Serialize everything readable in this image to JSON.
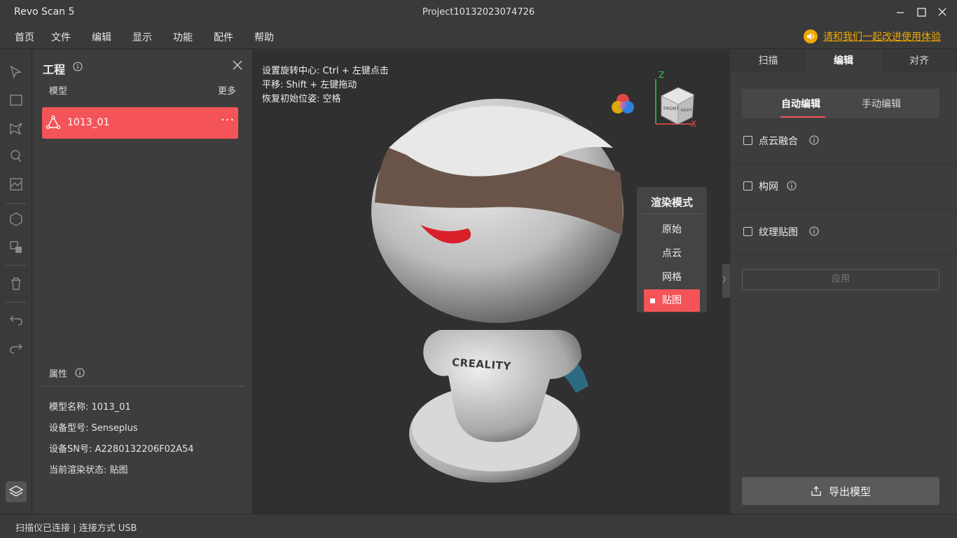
{
  "window": {
    "app_title": "Revo Scan 5",
    "project_title": "Project10132023074726"
  },
  "menu": {
    "items": [
      "首页",
      "文件",
      "编辑",
      "显示",
      "功能",
      "配件",
      "帮助"
    ],
    "feedback_link": "请和我们一起改进使用体验",
    "feedback_icon": "speaker-icon"
  },
  "tools": [
    "select-arrow-icon",
    "rect-select-icon",
    "lasso-icon",
    "brush-select-icon",
    "crop-icon",
    "mesh-cube-icon",
    "duplicate-icon",
    "trash-icon",
    "undo-icon",
    "redo-icon",
    "layers-icon"
  ],
  "project_panel": {
    "title": "工程",
    "models_label": "模型",
    "more_label": "更多",
    "model": {
      "name": "1013_01",
      "more": "···"
    },
    "attributes_label": "属性",
    "attributes": [
      {
        "label": "模型名称:",
        "value": "1013_01"
      },
      {
        "label": "设备型号:",
        "value": "Senseplus"
      },
      {
        "label": "设备SN号:",
        "value": "A2280132206F02A54"
      },
      {
        "label": "当前渲染状态:",
        "value": "贴图"
      }
    ]
  },
  "viewport": {
    "hints": [
      "设置旋转中心: Ctrl + 左键点击",
      "平移: Shift + 左键拖动",
      "恢复初始位姿: 空格"
    ],
    "gizmo": {
      "z": "Z",
      "x": "X",
      "front": "FRONT",
      "right": "RIGHT"
    },
    "model_brand": "CREALITY",
    "render_mode": {
      "title": "渲染模式",
      "options": [
        "原始",
        "点云",
        "网格",
        "贴图"
      ],
      "selected": "贴图"
    },
    "collapse": "〉"
  },
  "right_panel": {
    "tabs": [
      "扫描",
      "编辑",
      "对齐"
    ],
    "active_tab": "编辑",
    "subtabs": [
      "自动编辑",
      "手动编辑"
    ],
    "active_subtab": "自动编辑",
    "options": [
      {
        "label": "点云融合",
        "checked": false
      },
      {
        "label": "构网",
        "checked": false
      },
      {
        "label": "纹理贴图",
        "checked": false
      }
    ],
    "apply_label": "应用",
    "export_label": "导出模型"
  },
  "status": {
    "text": "扫描仪已连接 | 连接方式 USB"
  },
  "colors": {
    "accent": "#f45458",
    "feedback": "#f0a800",
    "background": "#3a3a3a"
  }
}
